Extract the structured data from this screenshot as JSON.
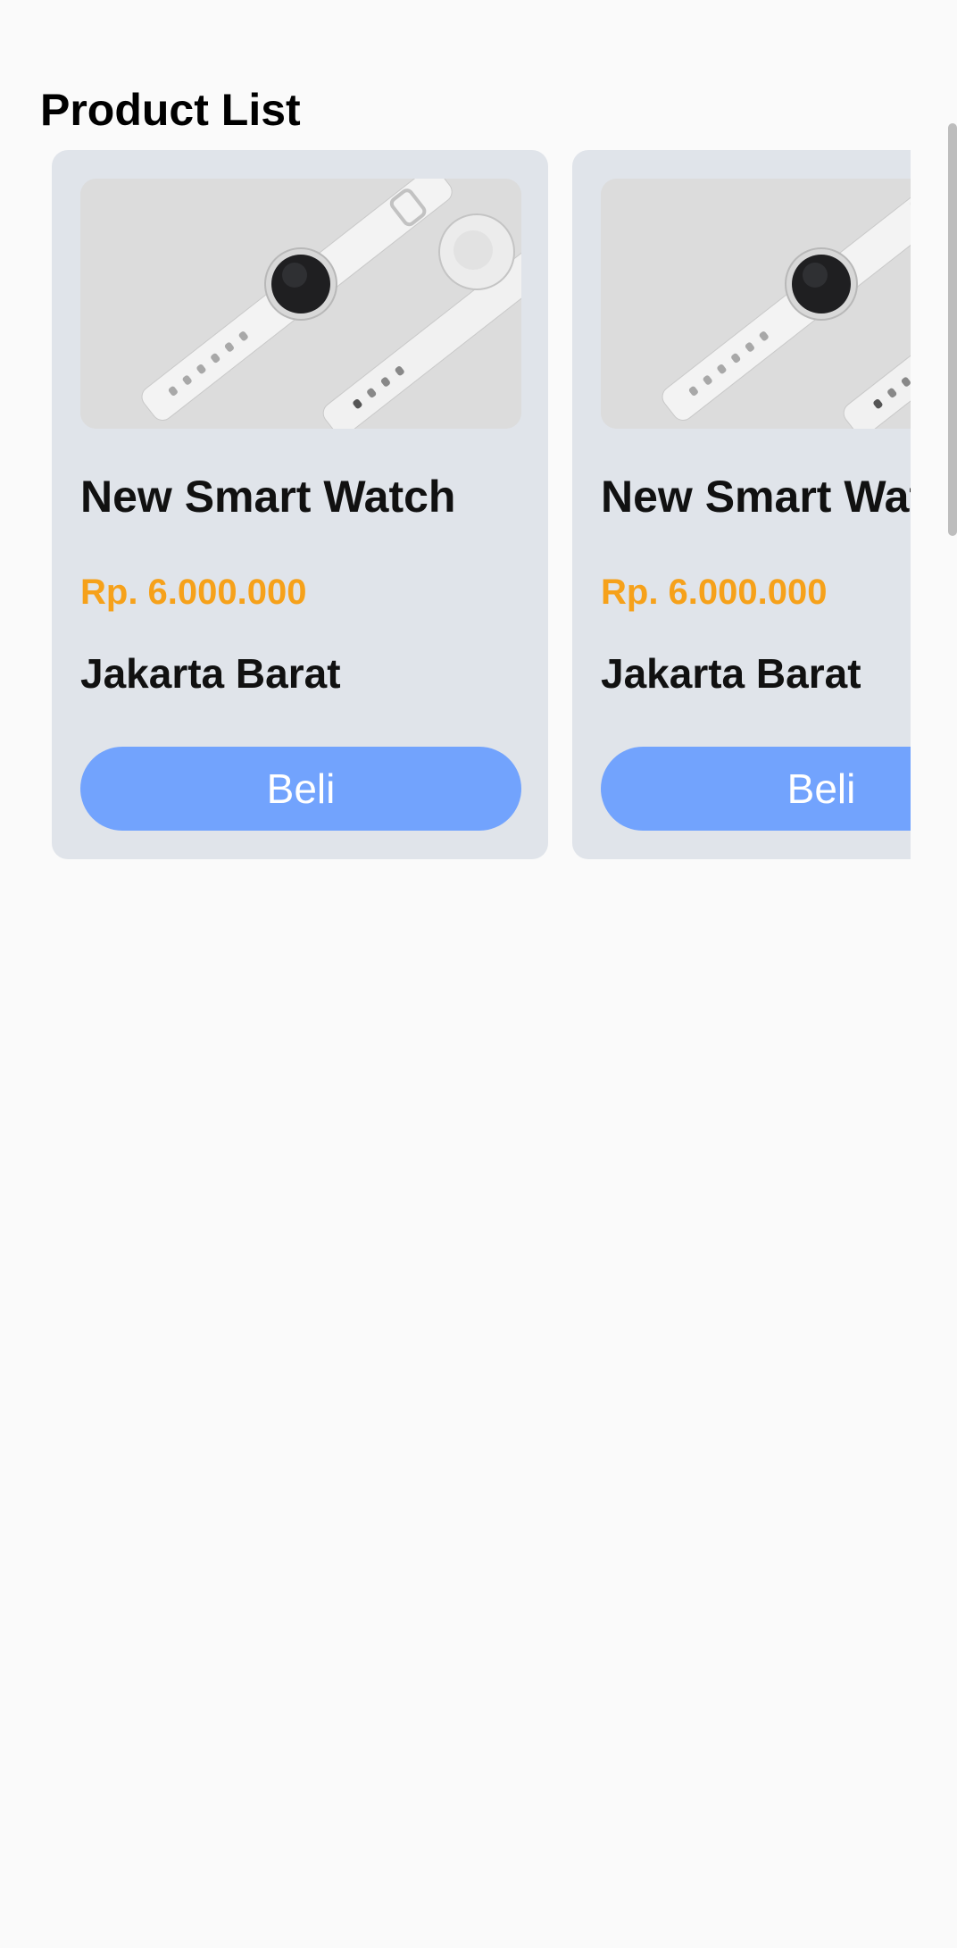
{
  "page": {
    "title": "Product List"
  },
  "products": [
    {
      "name": "New Smart Watch",
      "price": "Rp. 6.000.000",
      "location": "Jakarta Barat",
      "buy_label": "Beli",
      "image_icon": "smartwatch-image"
    },
    {
      "name": "New Smart Watch",
      "price": "Rp. 6.000.000",
      "location": "Jakarta Barat",
      "buy_label": "Beli",
      "image_icon": "smartwatch-image"
    }
  ],
  "colors": {
    "background": "#fafafa",
    "card": "#e0e4ea",
    "price": "#f6a11a",
    "button": "#72a3fd",
    "button_text": "#ffffff"
  }
}
